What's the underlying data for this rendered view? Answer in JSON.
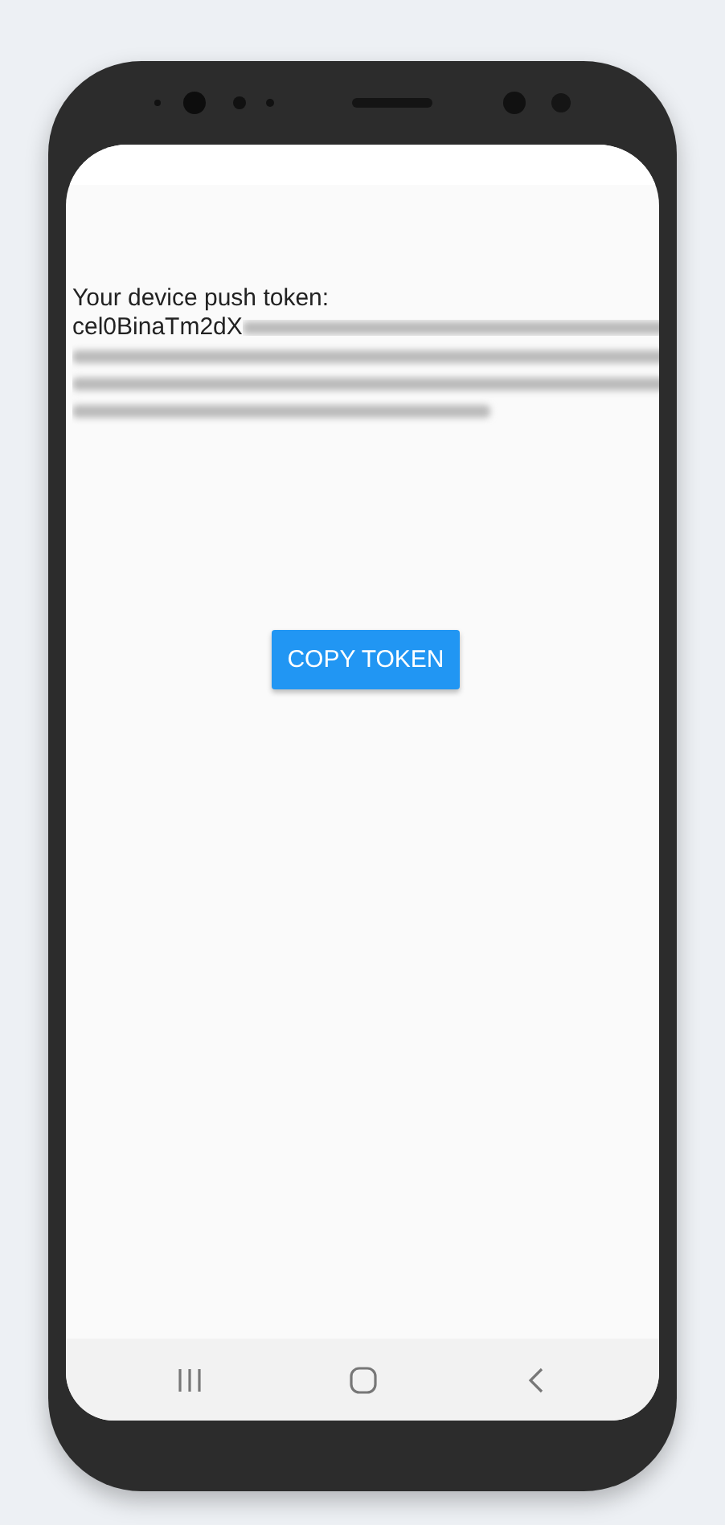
{
  "token_label": "Your device push token:",
  "token_visible": "cel0BinaTm2dX",
  "copy_button": {
    "label": "COPY TOKEN"
  }
}
